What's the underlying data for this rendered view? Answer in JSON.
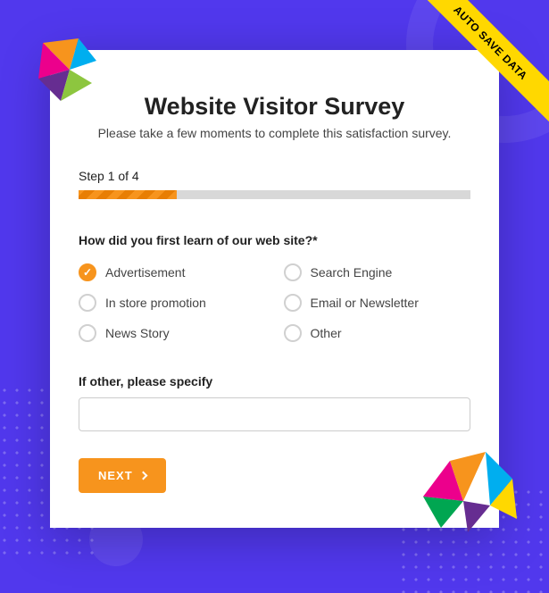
{
  "ribbon": {
    "text": "AUTO SAVE DATA"
  },
  "header": {
    "title": "Website Visitor Survey",
    "subtitle": "Please take a few moments to complete this satisfaction survey."
  },
  "progress": {
    "step_label": "Step 1 of 4",
    "current": 1,
    "total": 4
  },
  "question": {
    "text": "How did you first learn of our web site?*",
    "selected": "advertisement",
    "options": [
      {
        "id": "advertisement",
        "label": "Advertisement"
      },
      {
        "id": "search_engine",
        "label": "Search Engine"
      },
      {
        "id": "in_store",
        "label": "In store promotion"
      },
      {
        "id": "email",
        "label": "Email or Newsletter"
      },
      {
        "id": "news",
        "label": "News Story"
      },
      {
        "id": "other",
        "label": "Other"
      }
    ]
  },
  "other_field": {
    "label": "If other, please specify",
    "value": ""
  },
  "actions": {
    "next_label": "NEXT"
  }
}
